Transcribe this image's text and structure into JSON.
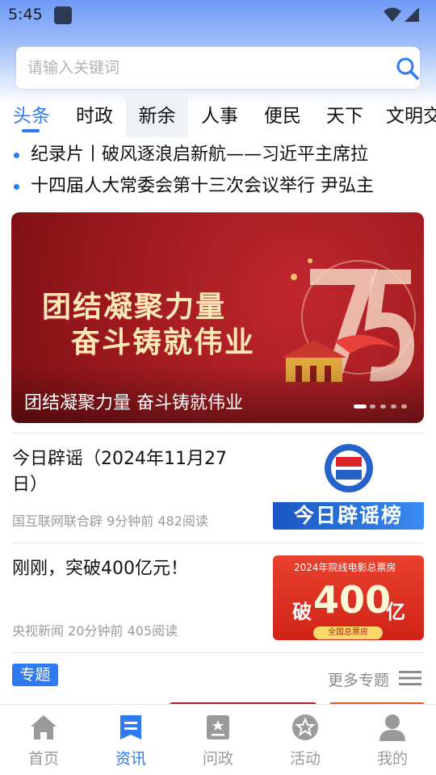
{
  "status_bar": {
    "time": "5:45"
  },
  "search": {
    "placeholder": "请输入关键词"
  },
  "tabs": [
    {
      "label": "头条"
    },
    {
      "label": "时政"
    },
    {
      "label": "新余"
    },
    {
      "label": "人事"
    },
    {
      "label": "便民"
    },
    {
      "label": "天下"
    },
    {
      "label": "文明交"
    }
  ],
  "ticker": [
    {
      "text": "纪录片丨破风逐浪启新航——习近平主席拉"
    },
    {
      "text": "十四届人大常委会第十三次会议举行 尹弘主"
    }
  ],
  "banner": {
    "line1": "团结凝聚力量",
    "line2": "奋斗铸就伟业",
    "caption": "团结凝聚力量 奋斗铸就伟业",
    "slide_count": 5,
    "active_slide": 1
  },
  "news": [
    {
      "title": "今日辟谣（2024年11月27日）",
      "meta": "国互联网联合辟 9分钟前 482阅读",
      "thumb_text": "今日辟谣榜"
    },
    {
      "title": "刚刚，突破400亿元！",
      "meta": "央视新闻 20分钟前 405阅读",
      "thumb_caption": "2024年院线电影总票房",
      "thumb_prefix": "破",
      "thumb_number": "400",
      "thumb_unit": "亿",
      "thumb_footer": "全国总票房"
    }
  ],
  "topics": {
    "badge": "专题",
    "more_label": "更多专题"
  },
  "bottom_nav": [
    {
      "label": "首页",
      "icon": "home-icon"
    },
    {
      "label": "资讯",
      "icon": "news-icon"
    },
    {
      "label": "问政",
      "icon": "inquiry-icon"
    },
    {
      "label": "活动",
      "icon": "star-badge-icon"
    },
    {
      "label": "我的",
      "icon": "user-icon"
    }
  ],
  "colors": {
    "accent": "#2f7af0",
    "banner_red": "#9e1a1f"
  }
}
